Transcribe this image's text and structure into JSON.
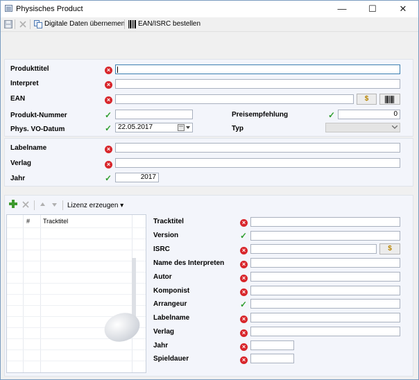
{
  "window": {
    "title": "Physisches Product",
    "minimize": "—",
    "maximize": "☐",
    "close": "✕"
  },
  "toolbar": {
    "digital_label": "Digitale Daten übernemen",
    "ean_label": "EAN/ISRC bestellen"
  },
  "product": {
    "produkttitel_label": "Produkttitel",
    "produkttitel_value": "",
    "interpret_label": "Interpret",
    "interpret_value": "",
    "ean_label": "EAN",
    "ean_value": "",
    "ean_button": "$",
    "nummer_label": "Produkt-Nummer",
    "nummer_value": "",
    "preis_label": "Preisempfehlung",
    "preis_value": "0",
    "vo_label": "Phys. VO-Datum",
    "vo_value": "22.05.2017",
    "typ_label": "Typ",
    "typ_value": ""
  },
  "label_section": {
    "labelname_label": "Labelname",
    "labelname_value": "",
    "verlag_label": "Verlag",
    "verlag_value": "",
    "jahr_label": "Jahr",
    "jahr_value": "2017"
  },
  "tracks_toolbar": {
    "lizenz_label": "Lizenz erzeugen"
  },
  "track_list": {
    "col_num": "#",
    "col_title": "Tracktitel"
  },
  "track_form": {
    "tracktitel": "Tracktitel",
    "version": "Version",
    "isrc": "ISRC",
    "isrc_button": "$",
    "name_interpreten": "Name des Interpreten",
    "autor": "Autor",
    "komponist": "Komponist",
    "arrangeur": "Arrangeur",
    "labelname": "Labelname",
    "verlag": "Verlag",
    "jahr": "Jahr",
    "spieldauer": "Spieldauer"
  },
  "colors": {
    "error": "#d8262b",
    "ok": "#2f9e2f",
    "focus_border": "#3c7fb1"
  }
}
